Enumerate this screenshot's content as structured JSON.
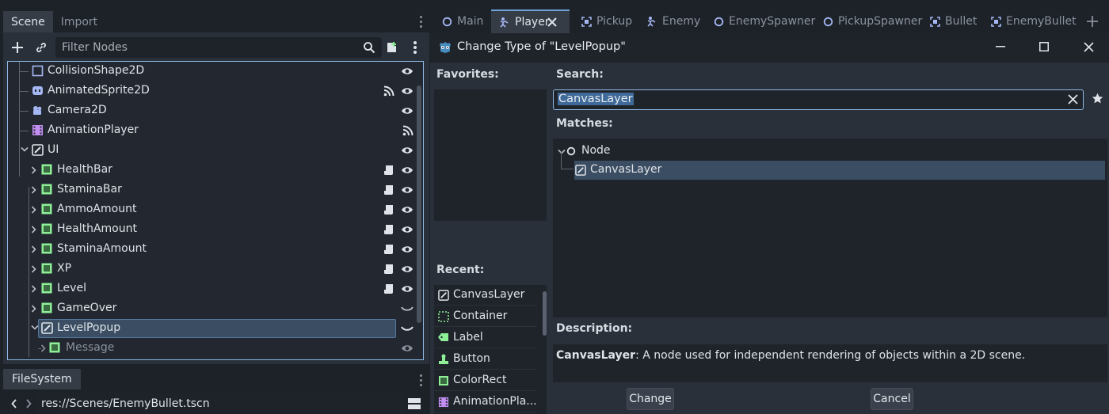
{
  "left_dock": {
    "tabs": [
      {
        "label": "Scene",
        "active": true
      },
      {
        "label": "Import",
        "active": false
      }
    ]
  },
  "scene": {
    "filter_placeholder": "Filter Nodes",
    "nodes": [
      {
        "label": "CollisionShape2D",
        "icon": "collision-shape-icon",
        "depth": 1,
        "visible": true
      },
      {
        "label": "AnimatedSprite2D",
        "icon": "animated-sprite-icon",
        "depth": 1,
        "visible": true,
        "signals": true
      },
      {
        "label": "Camera2D",
        "icon": "camera-icon",
        "depth": 1,
        "visible": true
      },
      {
        "label": "AnimationPlayer",
        "icon": "animation-player-icon",
        "depth": 1,
        "signals": true
      },
      {
        "label": "UI",
        "icon": "canvas-layer-icon",
        "depth": 1,
        "expanded": true,
        "visible": true
      },
      {
        "label": "HealthBar",
        "icon": "control-icon",
        "depth": 2,
        "script": true,
        "visible": true
      },
      {
        "label": "StaminaBar",
        "icon": "control-icon",
        "depth": 2,
        "script": true,
        "visible": true
      },
      {
        "label": "AmmoAmount",
        "icon": "control-icon",
        "depth": 2,
        "script": true,
        "visible": true
      },
      {
        "label": "HealthAmount",
        "icon": "control-icon",
        "depth": 2,
        "script": true,
        "visible": true
      },
      {
        "label": "StaminaAmount",
        "icon": "control-icon",
        "depth": 2,
        "script": true,
        "visible": true
      },
      {
        "label": "XP",
        "icon": "control-icon",
        "depth": 2,
        "script": true,
        "visible": true
      },
      {
        "label": "Level",
        "icon": "control-icon",
        "depth": 2,
        "script": true,
        "visible": true
      },
      {
        "label": "GameOver",
        "icon": "control-icon",
        "depth": 2,
        "hidden": true
      },
      {
        "label": "LevelPopup",
        "icon": "canvas-layer-icon",
        "depth": 2,
        "selected": true,
        "expanded": true,
        "hidden": true
      },
      {
        "label": "Message",
        "icon": "control-icon",
        "depth": 3,
        "dim": true,
        "visible": true
      }
    ]
  },
  "filesystem": {
    "tab_label": "FileSystem",
    "path": "res://Scenes/EnemyBullet.tscn"
  },
  "editor_tabs": [
    {
      "label": "Main",
      "icon": "node-icon"
    },
    {
      "label": "Player",
      "icon": "player-icon",
      "active": true
    },
    {
      "label": "Pickup",
      "icon": "area-icon"
    },
    {
      "label": "Enemy",
      "icon": "player-icon"
    },
    {
      "label": "EnemySpawner",
      "icon": "node-icon"
    },
    {
      "label": "PickupSpawner",
      "icon": "node-icon"
    },
    {
      "label": "Bullet",
      "icon": "area-icon"
    },
    {
      "label": "EnemyBullet",
      "icon": "area-icon"
    }
  ],
  "dialog": {
    "title": "Change Type of \"LevelPopup\"",
    "favorites_label": "Favorites:",
    "recent_label": "Recent:",
    "search_label": "Search:",
    "search_value": "CanvasLayer",
    "matches_label": "Matches:",
    "matches": [
      {
        "label": "Node",
        "icon": "node-icon"
      },
      {
        "label": "CanvasLayer",
        "icon": "canvas-layer-icon",
        "selected": true
      }
    ],
    "recent": [
      {
        "label": "CanvasLayer",
        "icon": "canvas-layer-icon"
      },
      {
        "label": "Container",
        "icon": "container-icon"
      },
      {
        "label": "Label",
        "icon": "label-icon"
      },
      {
        "label": "Button",
        "icon": "button-icon"
      },
      {
        "label": "ColorRect",
        "icon": "color-rect-icon"
      },
      {
        "label": "AnimationPla...",
        "icon": "animation-player-icon"
      }
    ],
    "description_label": "Description:",
    "description_name": "CanvasLayer",
    "description_text": ": A node used for independent rendering of objects within a 2D scene.",
    "change_label": "Change",
    "cancel_label": "Cancel"
  },
  "colors": {
    "accent": "#8cb9e6",
    "selection": "#3b4d62",
    "control_green": "#8eef97",
    "node_purple": "#a5b7f3",
    "anim_purple": "#c38ef1"
  }
}
